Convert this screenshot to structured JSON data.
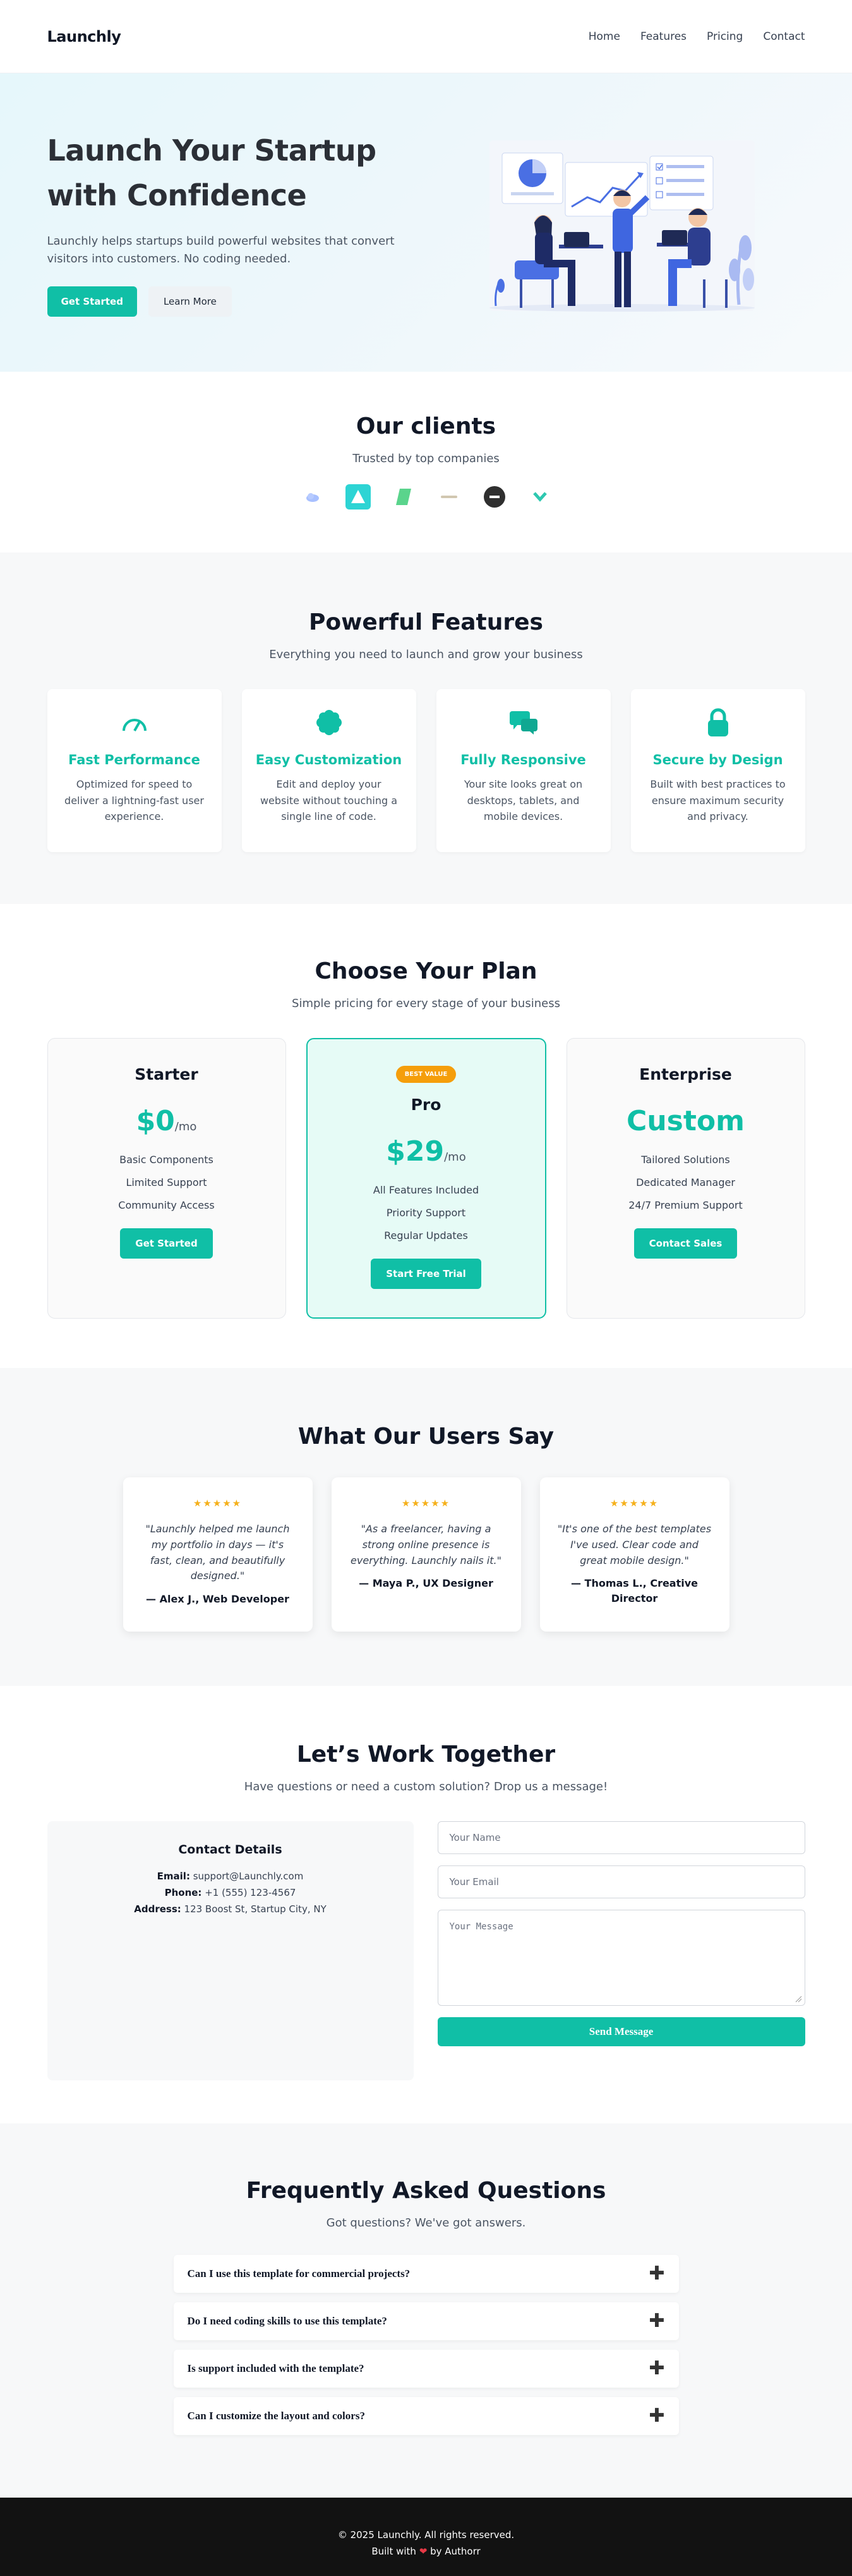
{
  "header": {
    "logo": "Launchly",
    "nav": [
      "Home",
      "Features",
      "Pricing",
      "Contact"
    ]
  },
  "hero": {
    "title": "Launch Your Startup with Confidence",
    "subtitle": "Launchly helps startups build powerful websites that convert visitors into customers. No coding needed.",
    "primary_button": "Get Started",
    "secondary_button": "Learn More"
  },
  "clients": {
    "title": "Our clients",
    "subtitle": "Trusted by top companies",
    "logos": [
      "cloud-logo",
      "triangle-logo",
      "parallelogram-logo",
      "wordmark-logo",
      "minus-circle-logo",
      "chevron-logo"
    ]
  },
  "features": {
    "title": "Powerful Features",
    "subtitle": "Everything you need to launch and grow your business",
    "items": [
      {
        "icon": "gauge-icon",
        "title": "Fast Performance",
        "desc": "Optimized for speed to deliver a lightning-fast user experience."
      },
      {
        "icon": "flower-icon",
        "title": "Easy Customization",
        "desc": "Edit and deploy your website without touching a single line of code."
      },
      {
        "icon": "chat-bubbles-icon",
        "title": "Fully Responsive",
        "desc": "Your site looks great on desktops, tablets, and mobile devices."
      },
      {
        "icon": "lock-icon",
        "title": "Secure by Design",
        "desc": "Built with best practices to ensure maximum security and privacy."
      }
    ]
  },
  "pricing": {
    "title": "Choose Your Plan",
    "subtitle": "Simple pricing for every stage of your business",
    "plans": [
      {
        "name": "Starter",
        "price": "$0",
        "period": "/mo",
        "features": [
          "Basic Components",
          "Limited Support",
          "Community Access"
        ],
        "button": "Get Started"
      },
      {
        "name": "Pro",
        "badge": "BEST VALUE",
        "price": "$29",
        "period": "/mo",
        "features": [
          "All Features Included",
          "Priority Support",
          "Regular Updates"
        ],
        "button": "Start Free Trial"
      },
      {
        "name": "Enterprise",
        "price": "Custom",
        "period": "",
        "features": [
          "Tailored Solutions",
          "Dedicated Manager",
          "24/7 Premium Support"
        ],
        "button": "Contact Sales"
      }
    ]
  },
  "testimonials": {
    "title": "What Our Users Say",
    "items": [
      {
        "stars": "★★★★★",
        "quote": "\"Launchly helped me launch my portfolio in days — it's fast, clean, and beautifully designed.\"",
        "author": "— Alex J., Web Developer"
      },
      {
        "stars": "★★★★★",
        "quote": "\"As a freelancer, having a strong online presence is everything. Launchly nails it.\"",
        "author": "— Maya P., UX Designer"
      },
      {
        "stars": "★★★★★",
        "quote": "\"It's one of the best templates I've used. Clear code and great mobile design.\"",
        "author": "— Thomas L., Creative Director"
      }
    ]
  },
  "contact": {
    "title": "Let’s Work Together",
    "subtitle": "Have questions or need a custom solution? Drop us a message!",
    "details_title": "Contact Details",
    "email_label": "Email:",
    "email": "support@Launchly.com",
    "phone_label": "Phone:",
    "phone": "+1 (555) 123-4567",
    "address_label": "Address:",
    "address": "123 Boost St, Startup City, NY",
    "name_placeholder": "Your Name",
    "email_placeholder": "Your Email",
    "message_placeholder": "Your Message",
    "send_button": "Send Message"
  },
  "faq": {
    "title": "Frequently Asked Questions",
    "subtitle": "Got questions? We've got answers.",
    "items": [
      "Can I use this template for commercial projects?",
      "Do I need coding skills to use this template?",
      "Is support included with the template?",
      "Can I customize the layout and colors?"
    ]
  },
  "footer": {
    "copyright": "© 2025 Launchly. All rights reserved.",
    "built_with": "Built with",
    "heart": "❤",
    "by": "by Authorr"
  },
  "colors": {
    "accent": "#10bfa6",
    "badge": "#f59e0b",
    "star": "#f5b01a",
    "footer_bg": "#121212"
  }
}
